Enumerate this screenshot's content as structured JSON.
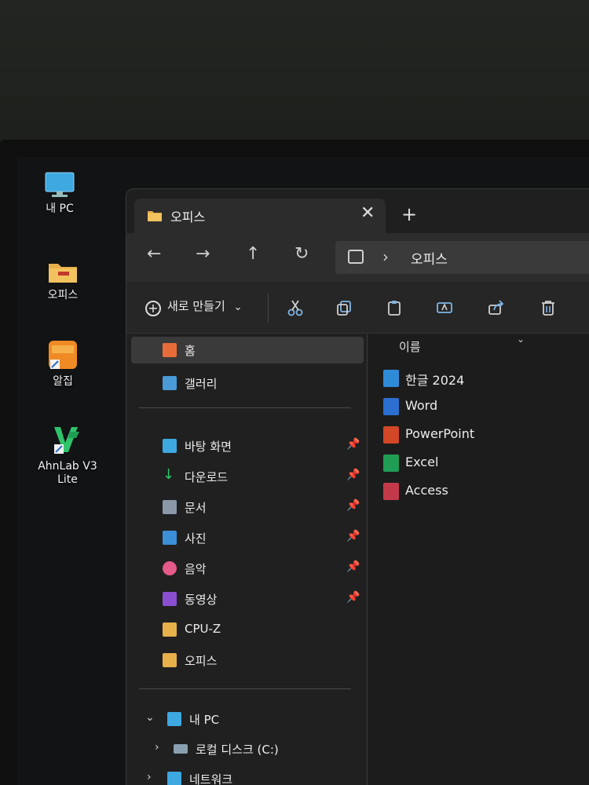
{
  "desktop": {
    "icons": [
      {
        "label": "내 PC"
      },
      {
        "label": "오피스"
      },
      {
        "label": "알집"
      },
      {
        "label": "AhnLab V3 Lite"
      }
    ]
  },
  "window": {
    "tab_title": "오피스",
    "close_glyph": "✕",
    "newtab_glyph": "+",
    "nav": {
      "back": "←",
      "forward": "→",
      "up": "↑",
      "refresh": "↻"
    },
    "address": {
      "separator": "›",
      "crumb": "오피스"
    },
    "toolbar": {
      "new_label": "새로 만들기",
      "new_caret": "⌄"
    },
    "sidebar": {
      "items": [
        {
          "label": "홈"
        },
        {
          "label": "갤러리"
        },
        {
          "label": "바탕 화면"
        },
        {
          "label": "다운로드"
        },
        {
          "label": "문서"
        },
        {
          "label": "사진"
        },
        {
          "label": "음악"
        },
        {
          "label": "동영상"
        },
        {
          "label": "CPU-Z"
        },
        {
          "label": "오피스"
        },
        {
          "label": "내 PC"
        },
        {
          "label": "로컬 디스크 (C:)"
        },
        {
          "label": "네트워크"
        }
      ]
    },
    "content": {
      "column_name": "이름",
      "files": [
        {
          "name": "한글 2024"
        },
        {
          "name": "Word"
        },
        {
          "name": "PowerPoint"
        },
        {
          "name": "Excel"
        },
        {
          "name": "Access"
        }
      ]
    }
  },
  "icons": {
    "pin": "pin-icon",
    "expand": "chevron-right-icon",
    "collapse": "chevron-down-icon"
  },
  "colors": {
    "accent": "#7fb5e8",
    "folder": "#e8b04a",
    "word": "#2b6fd1",
    "powerpoint": "#d24726",
    "excel": "#1f9d55",
    "access": "#c23a4a",
    "hangul": "#2e8bd8"
  }
}
